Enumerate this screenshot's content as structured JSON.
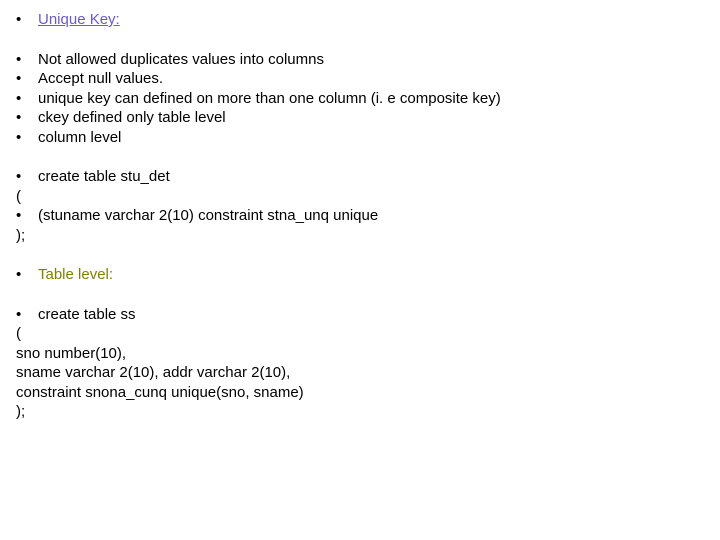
{
  "heading": "Unique Key:",
  "rules": [
    "Not allowed duplicates values into columns",
    "Accept null values.",
    "unique key can defined on more than one column (i. e composite key)",
    "ckey defined only table level",
    "column level"
  ],
  "create1": {
    "line1": "create table stu_det",
    "paren_open": "(",
    "line2": "(stuname varchar 2(10) constraint stna_unq unique",
    "paren_close": ");"
  },
  "sub_heading": "Table level:",
  "create2": {
    "line1": "create table ss",
    "paren_open": "(",
    "line2": "sno number(10),",
    "line3": "sname varchar 2(10), addr varchar 2(10),",
    "line4": "constraint snona_cunq unique(sno, sname)",
    "paren_close": ");"
  },
  "bullet_char": "•"
}
